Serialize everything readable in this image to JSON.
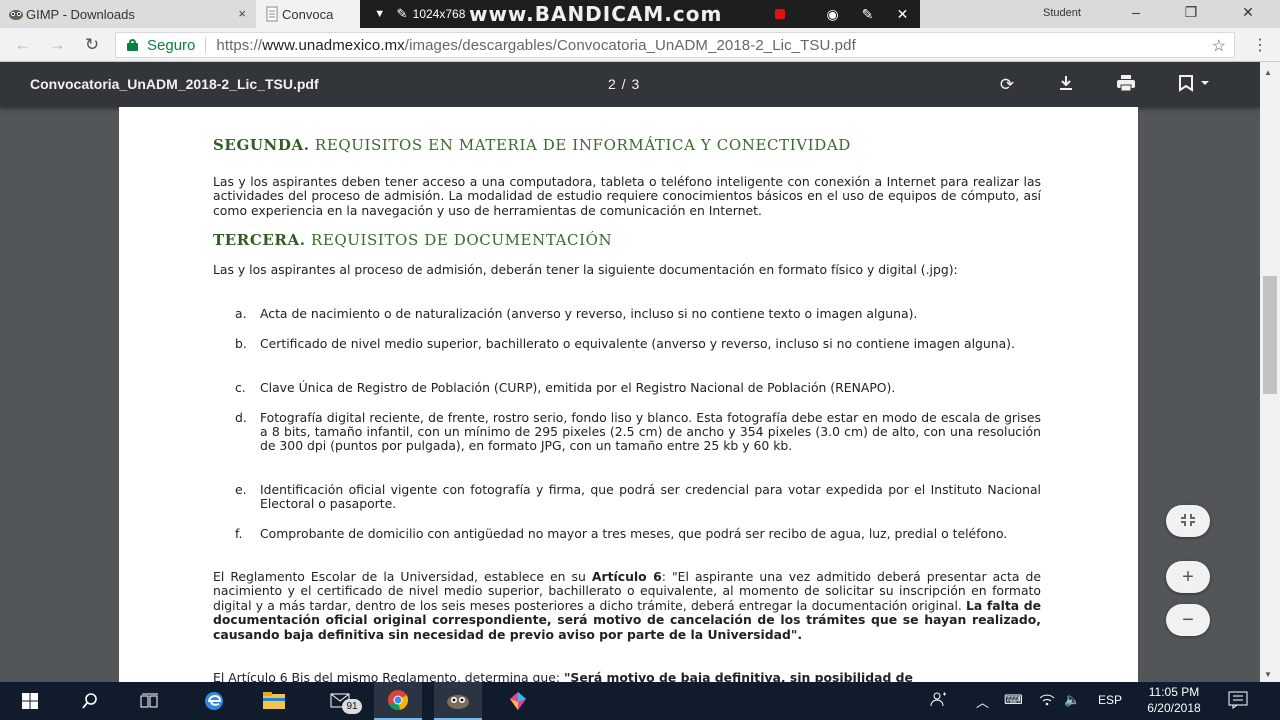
{
  "tabs": [
    {
      "title": "GIMP - Downloads",
      "close": "×"
    },
    {
      "title": "Convoca"
    }
  ],
  "recorder": {
    "resolution": "1024x768",
    "brand": "www.BANDICAM.com",
    "close": "✕"
  },
  "window": {
    "user": "Student",
    "minimize": "–",
    "maximize": "❐",
    "close": "✕"
  },
  "address_bar": {
    "secure_label": "Seguro",
    "url_scheme": "https://",
    "url_host": "www.unadmexico.mx",
    "url_path": "/images/descargables/Convocatoria_UnADM_2018-2_Lic_TSU.pdf"
  },
  "pdf_toolbar": {
    "filename": "Convocatoria_UnADM_2018-2_Lic_TSU.pdf",
    "page_indicator": "2  /  3"
  },
  "document": {
    "section2": {
      "number": "SEGUNDA.",
      "title": "REQUISITOS EN MATERIA DE INFORMÁTICA Y CONECTIVIDAD",
      "body": "Las y los aspirantes deben tener acceso a una computadora, tableta o teléfono inteligente con conexión a Internet para realizar las actividades del proceso de admisión. La modalidad de estudio requiere conocimientos básicos en el uso de equipos de cómputo, así como experiencia en la navegación y uso de herramientas de comunicación en Internet."
    },
    "section3": {
      "number": "TERCERA.",
      "title": "REQUISITOS DE DOCUMENTACIÓN",
      "intro": "Las y los aspirantes al proceso de admisión, deberán tener la siguiente documentación en formato físico y digital (.jpg):",
      "items": [
        {
          "letter": "a.",
          "text": "Acta de nacimiento o de naturalización (anverso y reverso, incluso si no contiene texto o imagen alguna)."
        },
        {
          "letter": "b.",
          "text": "Certificado de nivel medio superior, bachillerato o equivalente (anverso y reverso, incluso si no contiene imagen alguna)."
        },
        {
          "letter": "c.",
          "text": "Clave Única de Registro de Población (CURP), emitida por el Registro Nacional de Población (RENAPO)."
        },
        {
          "letter": "d.",
          "text": "Fotografía digital reciente, de frente, rostro serio, fondo liso y blanco. Esta fotografía debe estar en modo de escala de grises a 8 bits, tamaño infantil, con un mínimo de 295 pixeles (2.5 cm) de ancho y 354 pixeles (3.0 cm) de alto, con una resolución de 300 dpi (puntos por pulgada), en formato JPG, con un tamaño entre 25 kb y 60 kb."
        },
        {
          "letter": "e.",
          "text": "Identificación oficial vigente con fotografía y firma, que podrá ser credencial para votar expedida por el Instituto Nacional Electoral o pasaporte."
        },
        {
          "letter": "f.",
          "text": "Comprobante de domicilio con antigüedad no mayor a tres meses, que podrá ser recibo de agua, luz, predial o teléfono."
        }
      ],
      "reglamento_a": "El Reglamento Escolar de la Universidad, establece en su ",
      "reglamento_b": "Artículo 6",
      "reglamento_c": ": \"El aspirante una vez admitido deberá presentar acta de nacimiento y el certificado de nivel medio superior, bachillerato o equivalente, al momento de solicitar su inscripción en formato digital y a más tardar, dentro de los seis meses posteriores a dicho trámite, deberá entregar la documentación original. ",
      "reglamento_d": "La falta de documentación oficial original correspondiente, será motivo de cancelación de los trámites que se hayan realizado, causando baja definitiva sin necesidad de previo aviso por parte de la Universidad\".",
      "bis_a": "El Artículo 6 Bis del mismo Reglamento, determina que: ",
      "bis_b": "\"Será motivo de baja definitiva, sin posibilidad de"
    }
  },
  "taskbar": {
    "mail_badge": "91",
    "language": "ESP",
    "time": "11:05 PM",
    "date": "6/20/2018"
  },
  "icons": [
    "gimp-icon",
    "pdf-icon",
    "lock-icon",
    "star-icon",
    "rotate-icon",
    "download-icon",
    "print-icon",
    "bookmark-icon",
    "fit-icon",
    "zoom-in-icon",
    "zoom-out-icon",
    "windows-icon",
    "search-icon",
    "task-view-icon",
    "edge-icon",
    "explorer-icon",
    "mail-icon",
    "chrome-icon",
    "gimp-taskbar-icon",
    "paint3d-icon"
  ]
}
